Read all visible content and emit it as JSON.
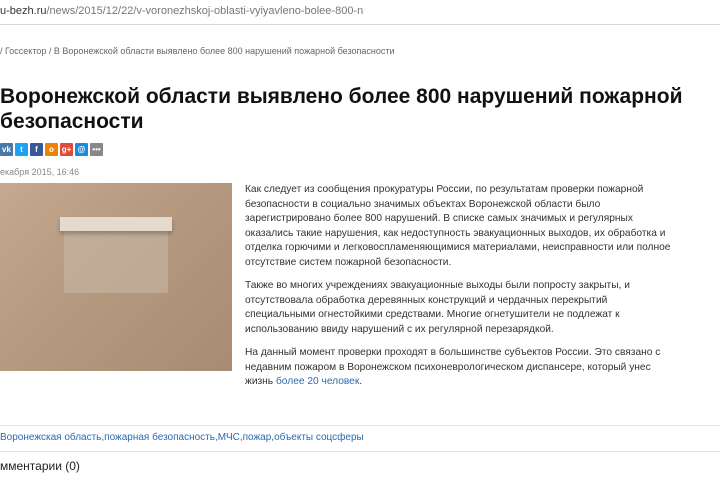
{
  "browser": {
    "url_domain": "u-bezh.ru",
    "url_path": "/news/2015/12/22/v-voronezhskoj-oblasti-vyiyavleno-bolee-800-n"
  },
  "breadcrumb": {
    "text": "/ Госсектор / В Воронежской области выявлено более 800 нарушений пожарной безопасности"
  },
  "article": {
    "title": "Воронежской области выявлено более 800 нарушений пожарной безопасности",
    "date": "екабря 2015, 16:46",
    "share_icons": [
      {
        "name": "vk-icon",
        "glyph": "vk",
        "color": "#4a76a8"
      },
      {
        "name": "twitter-icon",
        "glyph": "t",
        "color": "#1da1f2"
      },
      {
        "name": "facebook-icon",
        "glyph": "f",
        "color": "#3b5998"
      },
      {
        "name": "odnoklassniki-icon",
        "glyph": "o",
        "color": "#ee8208"
      },
      {
        "name": "google-plus-icon",
        "glyph": "g+",
        "color": "#dd4b39"
      },
      {
        "name": "mailru-icon",
        "glyph": "@",
        "color": "#168de2"
      },
      {
        "name": "more-icon",
        "glyph": "•••",
        "color": "#888888"
      }
    ],
    "p1": "Как следует из сообщения прокуратуры России, по результатам проверки пожарной безопасности в социально значимых объектах Воронежской области было зарегистрировано более 800 нарушений. В списке самых значимых и регулярных оказались такие нарушения, как недоступность эвакуационных выходов, их обработка и отделка горючими и легковоспламеняющимися материалами, неисправности или полное отсутствие систем пожарной безопасности.",
    "p2": "Также во многих учреждениях эвакуационные выходы были попросту закрыты, и отсутствовала обработка деревянных конструкций и чердачных перекрытий специальными огнестойкими средствами. Многие огнетушители не подлежат к использованию ввиду нарушений с их регулярной перезарядкой.",
    "p3_text": "На данный момент проверки проходят в большинстве субъектов России. Это связано с недавним пожаром в Воронежском психоневрологическом диспансере, который унес жизнь",
    "p3_link": "более 20 человек",
    "p3_end": "."
  },
  "tags": "Воронежская область,пожарная безопасность,МЧС,пожар,объекты соцсферы",
  "comments_label": "мментарии (0)"
}
